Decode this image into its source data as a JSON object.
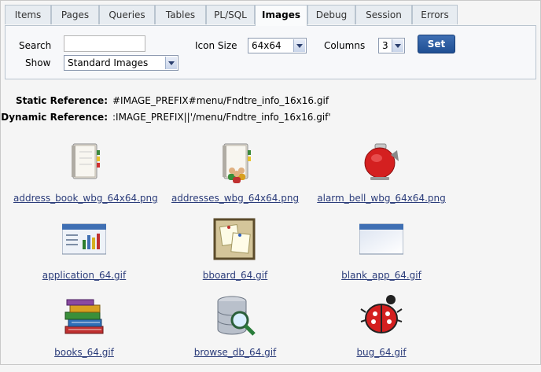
{
  "tabs": [
    {
      "label": "Items"
    },
    {
      "label": "Pages"
    },
    {
      "label": "Queries"
    },
    {
      "label": "Tables"
    },
    {
      "label": "PL/SQL"
    },
    {
      "label": "Images"
    },
    {
      "label": "Debug"
    },
    {
      "label": "Session"
    },
    {
      "label": "Errors"
    }
  ],
  "active_tab": "Images",
  "filters": {
    "search_label": "Search",
    "search_value": "",
    "icon_size_label": "Icon Size",
    "icon_size_value": "64x64",
    "columns_label": "Columns",
    "columns_value": "3",
    "show_label": "Show",
    "show_value": "Standard Images",
    "set_label": "Set"
  },
  "references": {
    "static_label": "Static Reference:",
    "static_value": "#IMAGE_PREFIX#menu/Fndtre_info_16x16.gif",
    "dynamic_label": "Dynamic Reference:",
    "dynamic_value": ":IMAGE_PREFIX||'/menu/Fndtre_info_16x16.gif'"
  },
  "images": [
    {
      "name": "address_book_wbg_64x64.png",
      "icon": "address-book-icon"
    },
    {
      "name": "addresses_wbg_64x64.png",
      "icon": "addresses-icon"
    },
    {
      "name": "alarm_bell_wbg_64x64.png",
      "icon": "alarm-bell-icon"
    },
    {
      "name": "application_64.gif",
      "icon": "application-icon"
    },
    {
      "name": "bboard_64.gif",
      "icon": "bulletin-board-icon"
    },
    {
      "name": "blank_app_64.gif",
      "icon": "blank-app-icon"
    },
    {
      "name": "books_64.gif",
      "icon": "books-icon"
    },
    {
      "name": "browse_db_64.gif",
      "icon": "browse-db-icon"
    },
    {
      "name": "bug_64.gif",
      "icon": "bug-icon"
    }
  ]
}
